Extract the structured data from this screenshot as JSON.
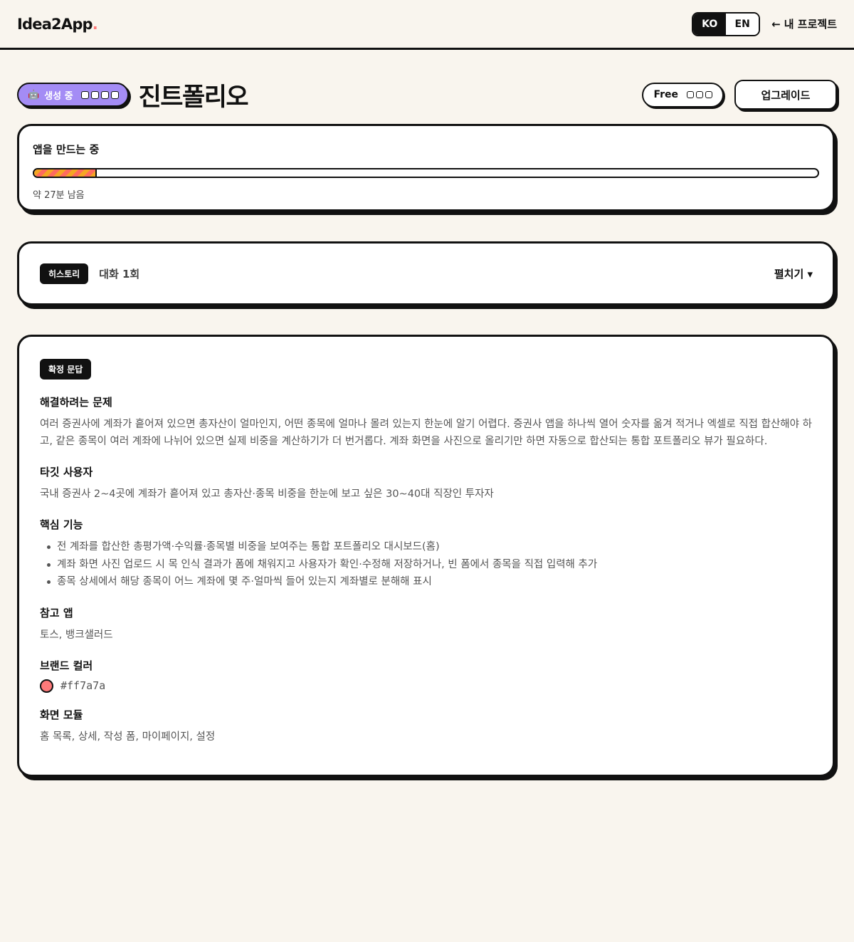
{
  "header": {
    "logo": "Idea2App",
    "logo_dot": ".",
    "languages": [
      {
        "label": "KO",
        "active": true
      },
      {
        "label": "EN",
        "active": false
      }
    ],
    "back_arrow": "←",
    "back_label": "내 프로젝트"
  },
  "title_bar": {
    "status_icon": "robot-icon",
    "status_label": "생성 중",
    "project_name": "진트폴리오",
    "plan_label": "Free",
    "upgrade_label": "업그레이드"
  },
  "progress": {
    "title": "앱을 만드는 중",
    "value_fraction": 0.08,
    "eta": "약 27분 남음"
  },
  "history": {
    "badge": "히스토리",
    "count": "대화 1회",
    "expand_label": "펼치기 ▾"
  },
  "spec": {
    "badge": "확정 문답",
    "problem": {
      "heading": "해결하려는 문제",
      "text": "여러 증권사에 계좌가 흩어져 있으면 총자산이 얼마인지, 어떤 종목에 얼마나 몰려 있는지 한눈에 알기 어렵다. 증권사 앱을 하나씩 열어 숫자를 옮겨 적거나 엑셀로 직접 합산해야 하고, 같은 종목이 여러 계좌에 나뉘어 있으면 실제 비중을 계산하기가 더 번거롭다. 계좌 화면을 사진으로 올리기만 하면 자동으로 합산되는 통합 포트폴리오 뷰가 필요하다."
    },
    "target": {
      "heading": "타깃 사용자",
      "text": "국내 증권사 2~4곳에 계좌가 흩어져 있고 총자산·종목 비중을 한눈에 보고 싶은 30~40대 직장인 투자자"
    },
    "features": {
      "heading": "핵심 기능",
      "items": [
        "전 계좌를 합산한 총평가액·수익률·종목별 비중을 보여주는 통합 포트폴리오 대시보드(홈)",
        "계좌 화면 사진 업로드 시 목 인식 결과가 폼에 채워지고 사용자가 확인·수정해 저장하거나, 빈 폼에서 종목을 직접 입력해 추가",
        "종목 상세에서 해당 종목이 어느 계좌에 몇 주·얼마씩 들어 있는지 계좌별로 분해해 표시"
      ]
    },
    "reference": {
      "heading": "참고 앱",
      "text": "토스, 뱅크샐러드"
    },
    "brand": {
      "heading": "브랜드 컬러",
      "color": "#ff7a7a",
      "hex_text": "#ff7a7a"
    },
    "modules": {
      "heading": "화면 모듈",
      "text": "홈 목록, 상세, 작성 폼, 마이페이지, 설정"
    }
  },
  "colors": {
    "background": "#f9f5ee",
    "accent_purple": "#a48cf5",
    "stripe_orange": "#f5a623",
    "stripe_coral": "#ff6b5e"
  }
}
